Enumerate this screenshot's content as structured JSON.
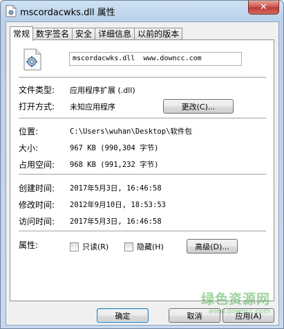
{
  "window": {
    "title": "mscordacwks.dll 属性",
    "close_label": "✕"
  },
  "tabs": [
    {
      "label": "常规",
      "active": true
    },
    {
      "label": "数字签名",
      "active": false
    },
    {
      "label": "安全",
      "active": false
    },
    {
      "label": "详细信息",
      "active": false
    },
    {
      "label": "以前的版本",
      "active": false
    }
  ],
  "file": {
    "icon": "dll-gear-file-icon",
    "name_value": "mscordacwks.dll  www.downcc.com"
  },
  "props": {
    "type_label": "文件类型:",
    "type_value": "应用程序扩展 (.dll)",
    "open_label": "打开方式:",
    "open_value": "未知应用程序",
    "change_button": "更改(C)...",
    "location_label": "位置:",
    "location_value": "C:\\Users\\wuhan\\Desktop\\软件包",
    "size_label": "大小:",
    "size_value": "967 KB (990,304 字节)",
    "disk_label": "占用空间:",
    "disk_value": "968 KB (991,232 字节)",
    "created_label": "创建时间:",
    "created_value": "2017年5月3日, 16:46:58",
    "modified_label": "修改时间:",
    "modified_value": "2012年9月10日, 18:53:53",
    "accessed_label": "访问时间:",
    "accessed_value": "2017年5月3日, 16:46:58",
    "attr_label": "属性:",
    "readonly_label": "只读(R)",
    "hidden_label": "隐藏(H)",
    "advanced_button": "高级(D)..."
  },
  "footer": {
    "ok_button": "确定",
    "cancel_button": "取消",
    "apply_button": "应用(A)"
  },
  "watermark": {
    "text": "绿色资源网",
    "url": "www.downcc.com"
  },
  "colors": {
    "title_gradient_top": "#cfe2f3",
    "close_red": "#c75050",
    "watermark_green": "#4db14d"
  }
}
